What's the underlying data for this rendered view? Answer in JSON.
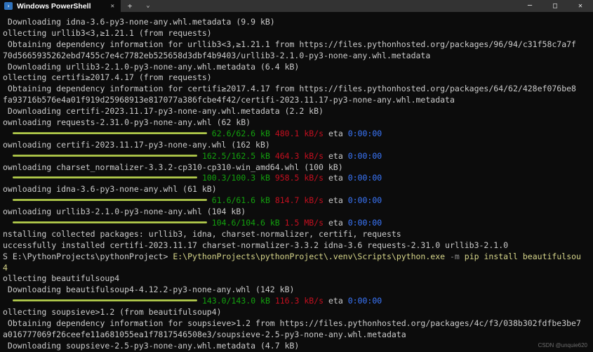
{
  "window": {
    "tab": {
      "title": "Windows PowerShell",
      "close_glyph": "✕"
    },
    "new_tab_glyph": "+",
    "dropdown_glyph": "⌄",
    "controls": {
      "minimize": "─",
      "maximize": "□",
      "close": "✕"
    },
    "icon_glyph": "›"
  },
  "palette": {
    "bg": "#0c0c0c",
    "titlebar": "#333333",
    "fg": "#cccccc",
    "green": "#13a10e",
    "red": "#c50f1f",
    "blue": "#3b78ff",
    "yellow": "#d6d58a",
    "gray": "#8f8f8f",
    "bar": "#a3bc3f",
    "icon": "#2f72bc"
  },
  "terminal": {
    "lines": [
      [
        {
          "s": " Downloading idna-3.6-py3-none-any.whl.metadata (9.9 kB)",
          "c": "fg"
        }
      ],
      [
        {
          "s": "ollecting urllib3<3,≥1.21.1 (from requests)",
          "c": "fg"
        }
      ],
      [
        {
          "s": " Obtaining dependency information for urllib3<3,≥1.21.1 from https://files.pythonhosted.org/packages/96/94/c31f58c7a7f",
          "c": "fg"
        }
      ],
      [
        {
          "s": "70d5665935262ebd7455c7e4c7782eb525658d3dbf4b9403/urllib3-2.1.0-py3-none-any.whl.metadata",
          "c": "fg"
        }
      ],
      [
        {
          "s": " Downloading urllib3-2.1.0-py3-none-any.whl.metadata (6.4 kB)",
          "c": "fg"
        }
      ],
      [
        {
          "s": "ollecting certifi≥2017.4.17 (from requests)",
          "c": "fg"
        }
      ],
      [
        {
          "s": " Obtaining dependency information for certifi≥2017.4.17 from https://files.pythonhosted.org/packages/64/62/428ef076be8",
          "c": "fg"
        }
      ],
      [
        {
          "s": "fa93716b576e4a01f919d25968913e817077a386fcbe4f42/certifi-2023.11.17-py3-none-any.whl.metadata",
          "c": "fg"
        }
      ],
      [
        {
          "s": " Downloading certifi-2023.11.17-py3-none-any.whl.metadata (2.2 kB)",
          "c": "fg"
        }
      ],
      [
        {
          "s": "ownloading requests-2.31.0-py3-none-any.whl (62 kB)",
          "c": "fg"
        }
      ],
      [
        {
          "s": "  ",
          "c": "fg"
        },
        {
          "bar": 40
        },
        {
          "s": "62.6/62.6 kB",
          "c": "green"
        },
        {
          "s": " ",
          "c": "fg"
        },
        {
          "s": "480.1 kB/s",
          "c": "red"
        },
        {
          "s": " eta ",
          "c": "fg"
        },
        {
          "s": "0:00:00",
          "c": "blue"
        }
      ],
      [
        {
          "s": "ownloading certifi-2023.11.17-py3-none-any.whl (162 kB)",
          "c": "fg"
        }
      ],
      [
        {
          "s": "  ",
          "c": "fg"
        },
        {
          "bar": 38
        },
        {
          "s": "162.5/162.5 kB",
          "c": "green"
        },
        {
          "s": " ",
          "c": "fg"
        },
        {
          "s": "464.3 kB/s",
          "c": "red"
        },
        {
          "s": " eta ",
          "c": "fg"
        },
        {
          "s": "0:00:00",
          "c": "blue"
        }
      ],
      [
        {
          "s": "ownloading charset_normalizer-3.3.2-cp310-cp310-win_amd64.whl (100 kB)",
          "c": "fg"
        }
      ],
      [
        {
          "s": "  ",
          "c": "fg"
        },
        {
          "bar": 38
        },
        {
          "s": "100.3/100.3 kB",
          "c": "green"
        },
        {
          "s": " ",
          "c": "fg"
        },
        {
          "s": "958.5 kB/s",
          "c": "red"
        },
        {
          "s": " eta ",
          "c": "fg"
        },
        {
          "s": "0:00:00",
          "c": "blue"
        }
      ],
      [
        {
          "s": "ownloading idna-3.6-py3-none-any.whl (61 kB)",
          "c": "fg"
        }
      ],
      [
        {
          "s": "  ",
          "c": "fg"
        },
        {
          "bar": 40
        },
        {
          "s": "61.6/61.6 kB",
          "c": "green"
        },
        {
          "s": " ",
          "c": "fg"
        },
        {
          "s": "814.7 kB/s",
          "c": "red"
        },
        {
          "s": " eta ",
          "c": "fg"
        },
        {
          "s": "0:00:00",
          "c": "blue"
        }
      ],
      [
        {
          "s": "ownloading urllib3-2.1.0-py3-none-any.whl (104 kB)",
          "c": "fg"
        }
      ],
      [
        {
          "s": "  ",
          "c": "fg"
        },
        {
          "bar": 40
        },
        {
          "s": "104.6/104.6 kB",
          "c": "green"
        },
        {
          "s": " ",
          "c": "fg"
        },
        {
          "s": "1.5 MB/s",
          "c": "red"
        },
        {
          "s": " eta ",
          "c": "fg"
        },
        {
          "s": "0:00:00",
          "c": "blue"
        }
      ],
      [
        {
          "s": "nstalling collected packages: urllib3, idna, charset-normalizer, certifi, requests",
          "c": "fg"
        }
      ],
      [
        {
          "s": "uccessfully installed certifi-2023.11.17 charset-normalizer-3.3.2 idna-3.6 requests-2.31.0 urllib3-2.1.0",
          "c": "fg"
        }
      ],
      [
        {
          "s": "S E:\\PythonProjects\\pythonProject> ",
          "c": "fg"
        },
        {
          "s": "E:\\PythonProjects\\pythonProject\\.venv\\Scripts\\python.exe",
          "c": "yellow"
        },
        {
          "s": " ",
          "c": "fg"
        },
        {
          "s": "-m",
          "c": "gray"
        },
        {
          "s": " ",
          "c": "fg"
        },
        {
          "s": "pip install beautifulsou",
          "c": "yellow"
        }
      ],
      [
        {
          "s": "4",
          "c": "yellow"
        }
      ],
      [
        {
          "s": "ollecting beautifulsoup4",
          "c": "fg"
        }
      ],
      [
        {
          "s": " Downloading beautifulsoup4-4.12.2-py3-none-any.whl (142 kB)",
          "c": "fg"
        }
      ],
      [
        {
          "s": "  ",
          "c": "fg"
        },
        {
          "bar": 38
        },
        {
          "s": "143.0/143.0 kB",
          "c": "green"
        },
        {
          "s": " ",
          "c": "fg"
        },
        {
          "s": "116.3 kB/s",
          "c": "red"
        },
        {
          "s": " eta ",
          "c": "fg"
        },
        {
          "s": "0:00:00",
          "c": "blue"
        }
      ],
      [
        {
          "s": "ollecting soupsieve>1.2 (from beautifulsoup4)",
          "c": "fg"
        }
      ],
      [
        {
          "s": " Obtaining dependency information for soupsieve>1.2 from https://files.pythonhosted.org/packages/4c/f3/038b302fdfbe3be7",
          "c": "fg"
        }
      ],
      [
        {
          "s": "a016777069f26ceefe11a681055ea1f7817546508e3/soupsieve-2.5-py3-none-any.whl.metadata",
          "c": "fg"
        }
      ],
      [
        {
          "s": " Downloading soupsieve-2.5-py3-none-any.whl.metadata (4.7 kB)",
          "c": "fg"
        }
      ]
    ]
  },
  "watermark": "CSDN @unquie620"
}
